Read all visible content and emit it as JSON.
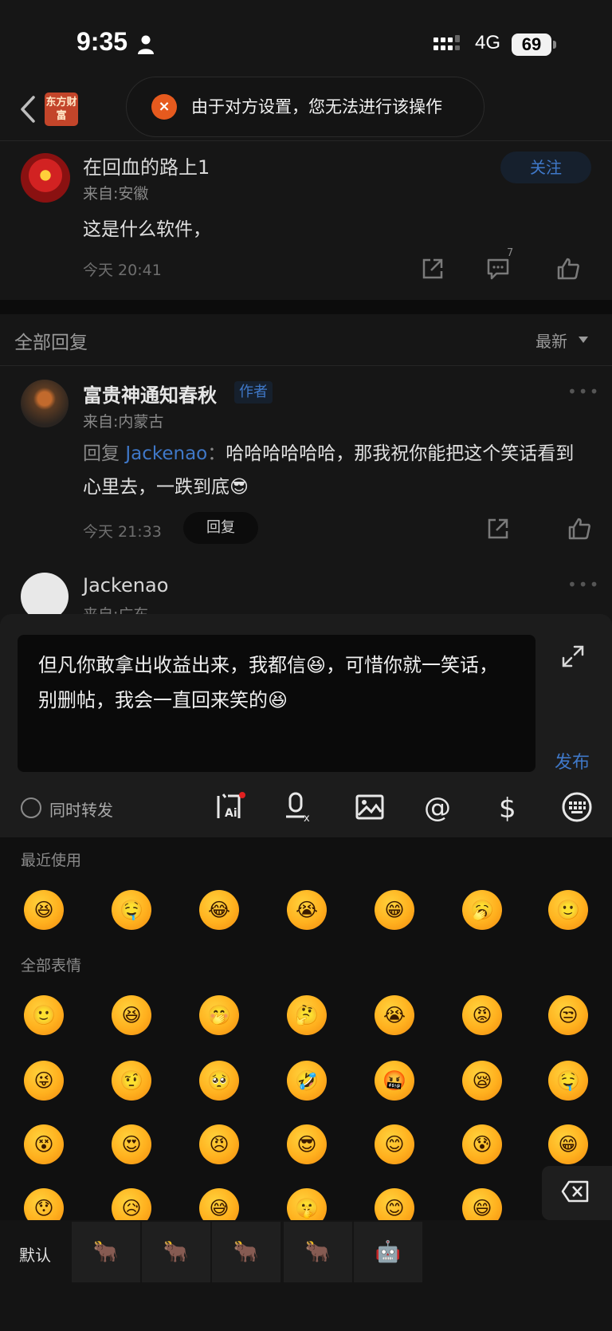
{
  "status": {
    "time": "9:35",
    "network": "4G",
    "battery": "69"
  },
  "header": {
    "logo_text": "东方财富",
    "toast": "由于对方设置，您无法进行该操作"
  },
  "post": {
    "username": "在回血的路上1",
    "location": "来自:安徽",
    "follow_label": "关注",
    "body": "这是什么软件，",
    "time": "今天 20:41",
    "comment_count": "7"
  },
  "replies": {
    "title": "全部回复",
    "sort": "最新",
    "items": [
      {
        "username": "富贵神通知春秋",
        "badge": "作者",
        "location": "来自:内蒙古",
        "prefix": "回复 ",
        "mention": "Jackenao",
        "separator": "：",
        "body": "哈哈哈哈哈哈，那我祝你能把这个笑话看到心里去，一跌到底😎",
        "time": "今天 21:33",
        "reply_label": "回复"
      },
      {
        "username": "Jackenao",
        "location": "来自:广东"
      }
    ]
  },
  "composer": {
    "text": "但凡你敢拿出收益出来，我都信😆，可惜你就一笑话，别删帖，我会一直回来笑的😆",
    "publish_label": "发布",
    "repost_label": "同时转发"
  },
  "emoji_panel": {
    "recent_label": "最近使用",
    "all_label": "全部表情",
    "recent": [
      "😆",
      "🤤",
      "😂",
      "😭",
      "😁",
      "🥱",
      "🙂"
    ],
    "all": [
      "🙂",
      "😆",
      "🤭",
      "🤔",
      "😭",
      "😡",
      "😒",
      "😜",
      "🤨",
      "🥺",
      "🤣",
      "🤬",
      "😪",
      "🤤",
      "😵",
      "😍",
      "😠",
      "😎",
      "😊",
      "😰",
      "😁",
      "😯",
      "😥",
      "😅",
      "🤫",
      "😊",
      "😄"
    ],
    "default_tab": "默认",
    "pack_tabs": [
      "🐂",
      "🐂",
      "🐂",
      "🐂",
      "🤖"
    ]
  }
}
